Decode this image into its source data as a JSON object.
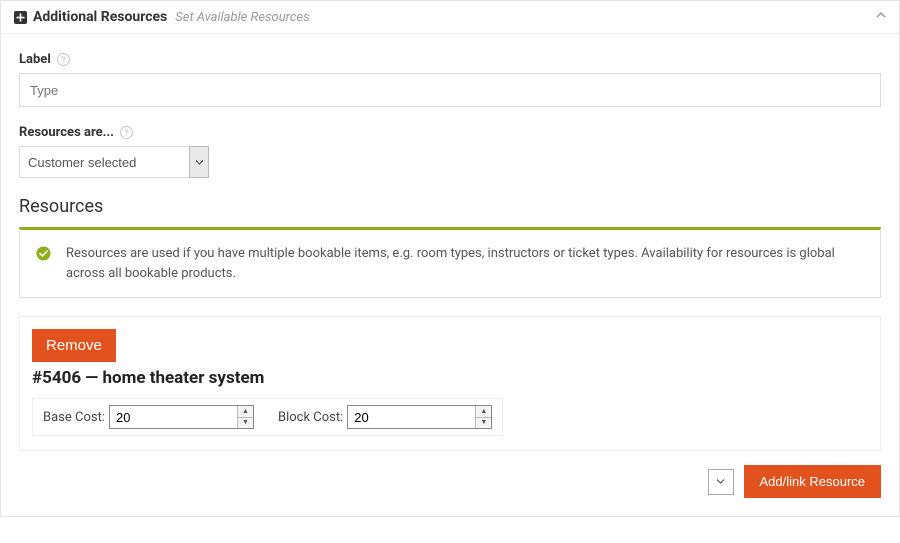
{
  "panel": {
    "title": "Additional Resources",
    "subtitle": "Set Available Resources"
  },
  "labelField": {
    "label": "Label",
    "placeholder": "Type",
    "value": ""
  },
  "resourcesAre": {
    "label": "Resources are...",
    "selected": "Customer selected"
  },
  "section": {
    "heading": "Resources",
    "notice": "Resources are used if you have multiple bookable items, e.g. room types, instructors or ticket types. Availability for resources is global across all bookable products."
  },
  "resource": {
    "remove_label": "Remove",
    "title": "#5406 — home theater system",
    "base_cost_label": "Base Cost:",
    "base_cost_value": "20",
    "block_cost_label": "Block Cost:",
    "block_cost_value": "20"
  },
  "footer": {
    "add_label": "Add/link Resource"
  }
}
